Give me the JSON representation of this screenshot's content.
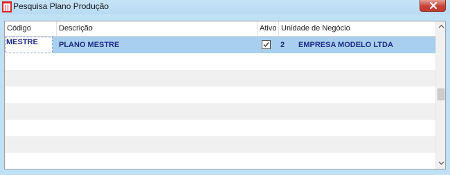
{
  "window": {
    "title": "Pesquisa Plano Produção"
  },
  "grid": {
    "columns": [
      {
        "key": "codigo",
        "label": "Código"
      },
      {
        "key": "descricao",
        "label": "Descrição"
      },
      {
        "key": "ativo",
        "label": "Ativo"
      },
      {
        "key": "unidade",
        "label": "Unidade de Negócio"
      }
    ],
    "rows": [
      {
        "codigo": "MESTRE",
        "descricao": "PLANO MESTRE",
        "ativo": true,
        "unidade_codigo": "2",
        "unidade_nome": "EMPRESA MODELO LTDA"
      }
    ]
  },
  "colors": {
    "titlebar": "#bfe0f5",
    "selected_row": "#a9cfee",
    "row_text": "#1c2a87",
    "close_button": "#c7443a"
  },
  "icons": {
    "app": "app-logo-icon",
    "close": "close-icon",
    "checkbox": "checkmark-icon",
    "scroll_up": "chevron-up-icon",
    "scroll_down": "chevron-down-icon"
  }
}
